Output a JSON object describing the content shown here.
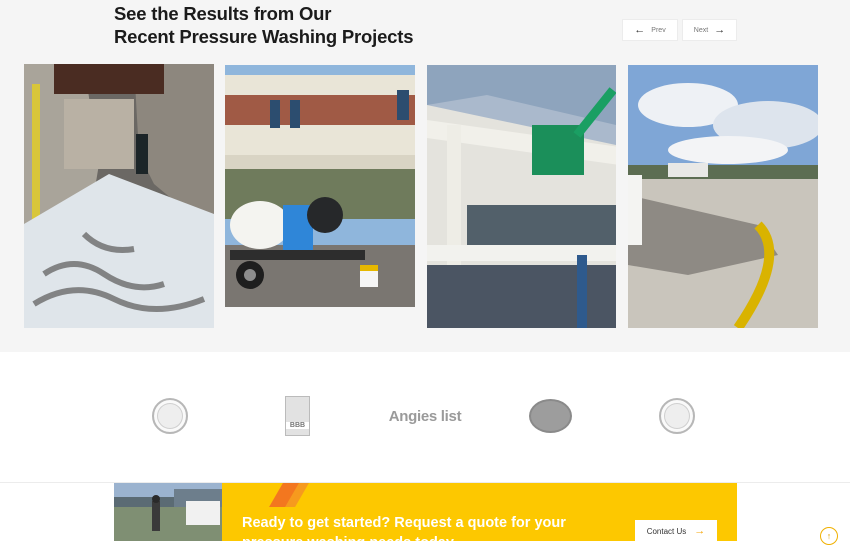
{
  "gallery": {
    "heading_line1": "See the Results from Our",
    "heading_line2": "Recent Pressure Washing Projects",
    "prev_label": "Prev",
    "next_label": "Next",
    "prev_icon": "arrow-left-icon",
    "next_icon": "arrow-right-icon",
    "photos": [
      {
        "subject": "washed loading dock passage"
      },
      {
        "subject": "pressure washing trailer rig beside building"
      },
      {
        "subject": "lift washing building facade"
      },
      {
        "subject": "cleaned parking lot curb"
      }
    ]
  },
  "badges": {
    "items": [
      "seal-badge",
      "bbb-badge",
      "angies-list-logo",
      "circular-award-badge",
      "seal-badge"
    ],
    "bbb_text": "BBB",
    "angies_text": "Angies list"
  },
  "cta": {
    "headline": "Ready to get started? Request a quote for your pressure washing needs today",
    "button_label": "Contact Us",
    "button_icon": "arrow-right-icon",
    "accent_color": "#fdc800",
    "stripe_color": "#f26e22"
  },
  "scroll_top": {
    "icon": "arrow-up-icon",
    "glyph": "↑"
  }
}
